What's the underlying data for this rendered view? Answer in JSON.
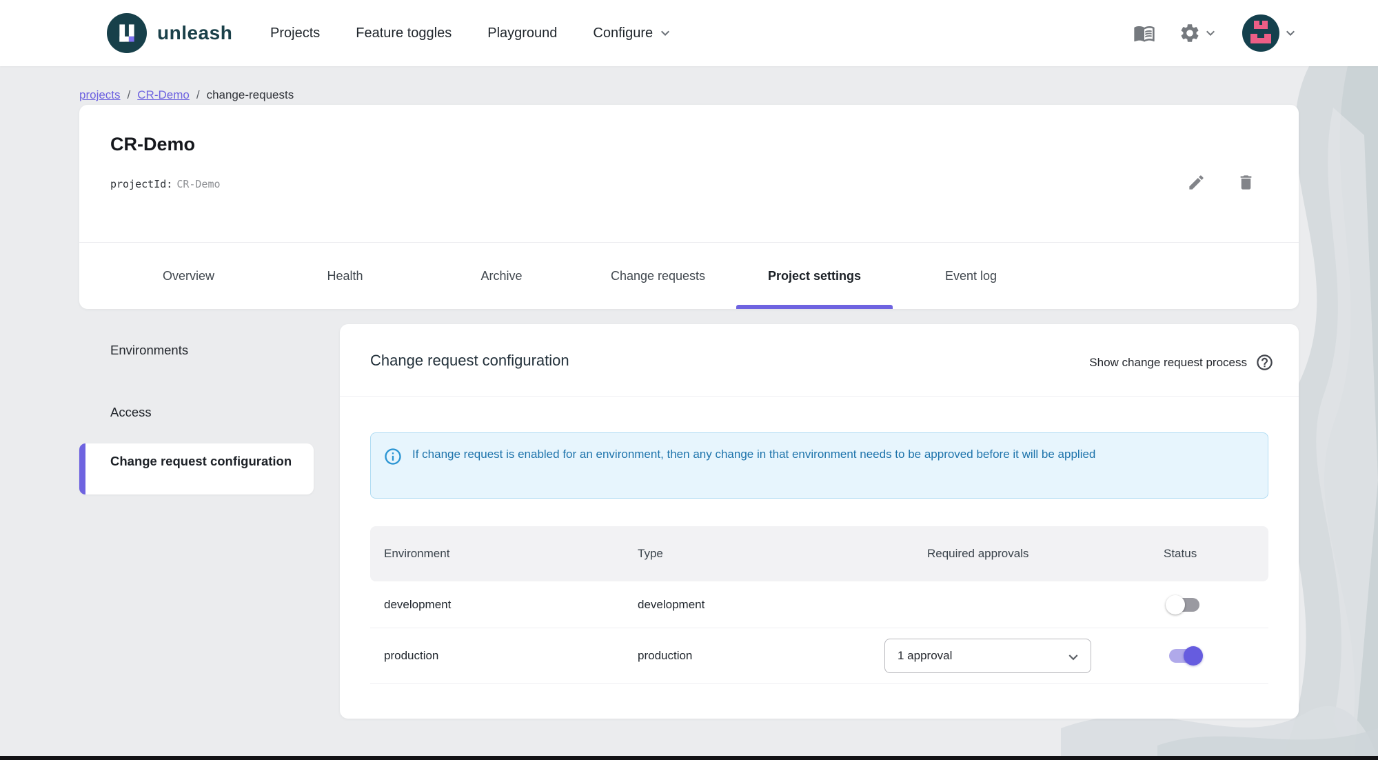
{
  "brand": {
    "name": "unleash"
  },
  "nav": {
    "items": [
      "Projects",
      "Feature toggles",
      "Playground",
      "Configure"
    ]
  },
  "breadcrumb": {
    "separator": "/",
    "items": [
      "projects",
      "CR-Demo",
      "change-requests"
    ]
  },
  "project": {
    "title": "CR-Demo",
    "project_id_label": "projectId:",
    "project_id_value": "CR-Demo"
  },
  "tabs": [
    {
      "label": "Overview",
      "active": false
    },
    {
      "label": "Health",
      "active": false
    },
    {
      "label": "Archive",
      "active": false
    },
    {
      "label": "Change requests",
      "active": false
    },
    {
      "label": "Project settings",
      "active": true
    },
    {
      "label": "Event log",
      "active": false
    }
  ],
  "sidebar": {
    "items": [
      {
        "label": "Environments",
        "active": false
      },
      {
        "label": "Access",
        "active": false
      },
      {
        "label": "Change request configuration",
        "active": true
      }
    ]
  },
  "panel": {
    "title": "Change request configuration",
    "action_label": "Show change request process",
    "alert": {
      "text": "If change request is enabled for an environment, then any change in that environment needs to be approved before it will be applied"
    },
    "table": {
      "headers": [
        "Environment",
        "Type",
        "Required approvals",
        "Status"
      ],
      "rows": [
        {
          "environment": "development",
          "type": "development",
          "required_approvals": "",
          "status_enabled": false
        },
        {
          "environment": "production",
          "type": "production",
          "required_approvals": "1 approval",
          "status_enabled": true
        }
      ]
    }
  },
  "colors": {
    "accent_purple": "#6e63e0",
    "brand_teal": "#1a4049",
    "avatar_pink": "#ec5e86",
    "page_background": "#ebecee",
    "alert_background": "#e7f5fd",
    "alert_text": "#1d73ab",
    "toggle_on_thumb": "#665cdf",
    "toggle_on_track": "#b0a9ea",
    "toggle_off_track": "#9a9aa1"
  }
}
